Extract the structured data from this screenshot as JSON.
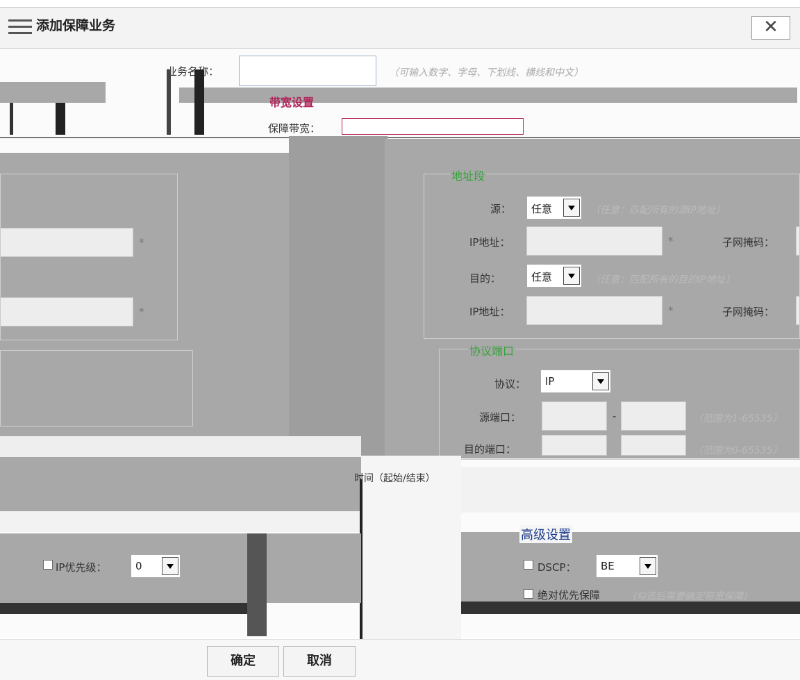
{
  "dialog": {
    "title": "添加保障业务",
    "close_label": "✕"
  },
  "business": {
    "name_label": "业务名称：",
    "name_value": "",
    "name_hint": "（可输入数字、字母、下划线、横线和中文）"
  },
  "bandwidth": {
    "legend": "带宽设置",
    "guarantee_label": "保障带宽："
  },
  "address": {
    "legend": "地址段",
    "source_label": "源：",
    "source_value": "任意",
    "source_hint": "（任意：匹配所有的源IP地址）",
    "ip_label_1": "IP地址：",
    "ip_label_2": "IP地址：",
    "required": "*",
    "mask_label_1": "子网掩码：",
    "mask_label_2": "子网掩码：",
    "dest_label": "目的：",
    "dest_value": "任意",
    "dest_hint": "（任意：匹配所有的目的IP地址）"
  },
  "left": {
    "req1": "*",
    "req2": "*"
  },
  "protocol": {
    "legend": "协议端口",
    "protocol_label": "协议：",
    "protocol_value": "IP",
    "src_port_label": "源端口：",
    "dst_port_label": "目的端口：",
    "dash": "-",
    "src_hint": "（范围为1-65535）",
    "dst_hint": "（范围为0-65535）"
  },
  "time": {
    "label": "时间（起始/结束）"
  },
  "advanced": {
    "legend": "高级设置",
    "dscp_label": "DSCP：",
    "dscp_value": "BE",
    "absolute_label": "绝对优先保障",
    "absolute_hint": "（勾选后需要确定带宽保障）"
  },
  "ip_priority": {
    "label": "IP优先级：",
    "value": "0"
  },
  "buttons": {
    "ok": "确定",
    "cancel": "取消"
  },
  "colors": {
    "band_legend": "#b0245a",
    "green_legend": "#36a33a",
    "blue_legend": "#1a3a8c"
  }
}
